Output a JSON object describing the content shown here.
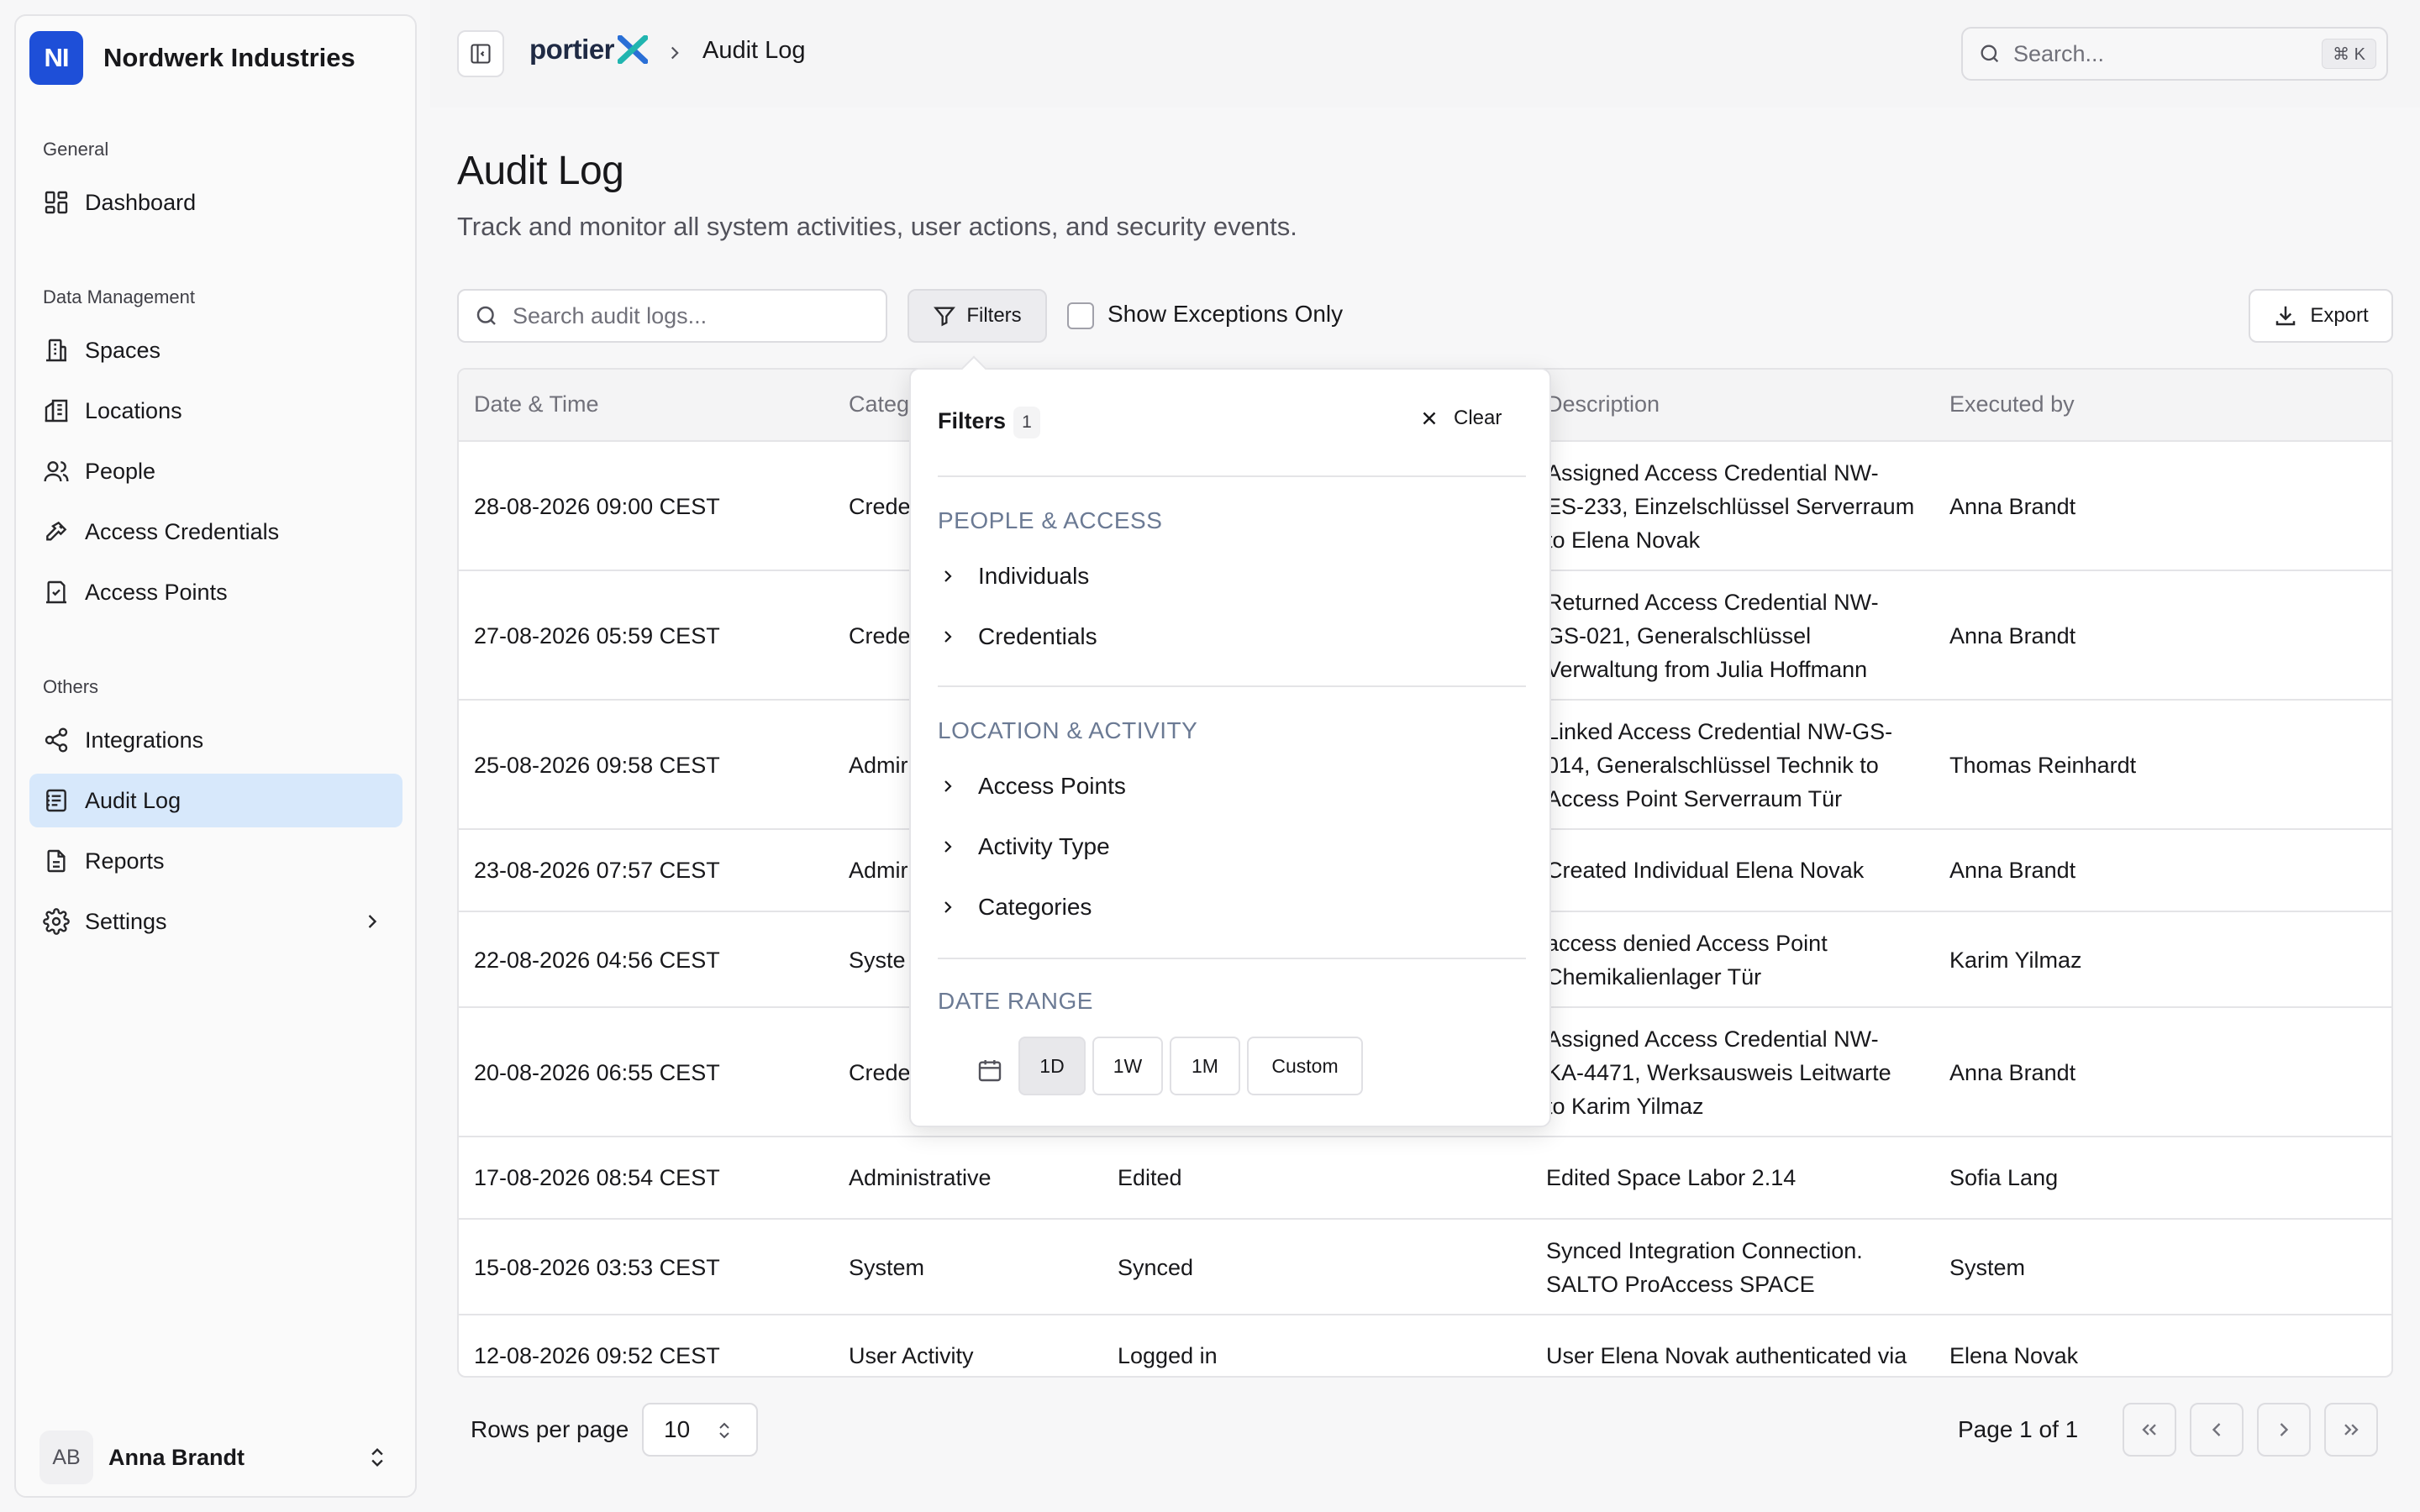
{
  "sidebar": {
    "brand_initials": "NI",
    "brand_name": "Nordwerk Industries",
    "section_general": "General",
    "section_data": "Data Management",
    "section_others": "Others",
    "items": [
      {
        "label": "Dashboard",
        "icon": "dashboard-icon"
      },
      {
        "label": "Spaces",
        "icon": "building-icon"
      },
      {
        "label": "Locations",
        "icon": "buildings-icon"
      },
      {
        "label": "People",
        "icon": "users-icon"
      },
      {
        "label": "Access Credentials",
        "icon": "key-icon"
      },
      {
        "label": "Access Points",
        "icon": "door-icon"
      },
      {
        "label": "Integrations",
        "icon": "share-icon"
      },
      {
        "label": "Audit Log",
        "icon": "log-icon",
        "active": true
      },
      {
        "label": "Reports",
        "icon": "report-icon"
      },
      {
        "label": "Settings",
        "icon": "gear-icon"
      }
    ],
    "user": {
      "initials": "AB",
      "name": "Anna Brandt"
    }
  },
  "topbar": {
    "logo_text": "portier",
    "breadcrumb_current": "Audit Log",
    "search_placeholder": "Search...",
    "search_shortcut": "⌘ K"
  },
  "header": {
    "title": "Audit Log",
    "subtitle": "Track and monitor all system activities, user actions, and security events."
  },
  "toolbar": {
    "search_placeholder": "Search audit logs...",
    "filters_label": "Filters",
    "exceptions_label": "Show Exceptions Only",
    "exceptions_checked": false,
    "export_label": "Export"
  },
  "table": {
    "columns": [
      "Date & Time",
      "Categ",
      "Description",
      "Executed by"
    ],
    "rows": [
      {
        "date": "28-08-2026 09:00 CEST",
        "category": "Crede",
        "activity": "",
        "description": [
          "Assigned Access Credential NW-",
          "ES-233, Einzelschlüssel Serverraum",
          "to Elena Novak"
        ],
        "executed_by": "Anna Brandt"
      },
      {
        "date": "27-08-2026 05:59 CEST",
        "category": "Crede",
        "activity": "",
        "description": [
          "Returned Access Credential NW-",
          "GS-021, Generalschlüssel",
          "Verwaltung from Julia Hoffmann"
        ],
        "executed_by": "Anna Brandt"
      },
      {
        "date": "25-08-2026 09:58 CEST",
        "category": "Admir",
        "activity": "",
        "description": [
          "Linked Access Credential NW-GS-",
          "014, Generalschlüssel Technik to",
          "Access Point Serverraum Tür"
        ],
        "executed_by": "Thomas Reinhardt"
      },
      {
        "date": "23-08-2026 07:57 CEST",
        "category": "Admir",
        "activity": "",
        "description": [
          "Created Individual Elena Novak"
        ],
        "executed_by": "Anna Brandt"
      },
      {
        "date": "22-08-2026 04:56 CEST",
        "category": "Syste",
        "activity": "",
        "description": [
          "access denied Access Point",
          "Chemikalienlager Tür"
        ],
        "executed_by": "Karim Yilmaz"
      },
      {
        "date": "20-08-2026 06:55 CEST",
        "category": "Crede",
        "activity": "",
        "description": [
          "Assigned Access Credential NW-",
          "KA-4471, Werksausweis Leitwarte",
          "to Karim Yilmaz"
        ],
        "executed_by": "Anna Brandt"
      },
      {
        "date": "17-08-2026 08:54 CEST",
        "category": "Administrative",
        "activity": "Edited",
        "description": [
          "Edited Space Labor 2.14"
        ],
        "executed_by": "Sofia Lang"
      },
      {
        "date": "15-08-2026 03:53 CEST",
        "category": "System",
        "activity": "Synced",
        "description": [
          "Synced Integration Connection.",
          "SALTO ProAccess SPACE"
        ],
        "executed_by": "System"
      },
      {
        "date": "12-08-2026 09:52 CEST",
        "category": "User Activity",
        "activity": "Logged in",
        "description": [
          "User Elena Novak authenticated via"
        ],
        "executed_by": "Elena Novak"
      }
    ]
  },
  "filters_popover": {
    "title": "Filters",
    "count": "1",
    "clear_label": "Clear",
    "section_people": "PEOPLE & ACCESS",
    "people_items": [
      "Individuals",
      "Credentials"
    ],
    "section_location": "LOCATION & ACTIVITY",
    "location_items": [
      "Access Points",
      "Activity Type",
      "Categories"
    ],
    "section_date": "DATE RANGE",
    "range_options": [
      "1D",
      "1W",
      "1M",
      "Custom"
    ],
    "range_selected": "1D"
  },
  "pagination": {
    "rows_per_page_label": "Rows per page",
    "rows_per_page_value": "10",
    "page_info": "Page 1 of 1"
  },
  "colors": {
    "brand": "#1e4fd8",
    "active_nav": "#d7e8fb",
    "portier_x_blue": "#2a6fd6",
    "portier_x_teal": "#21b5b0"
  }
}
